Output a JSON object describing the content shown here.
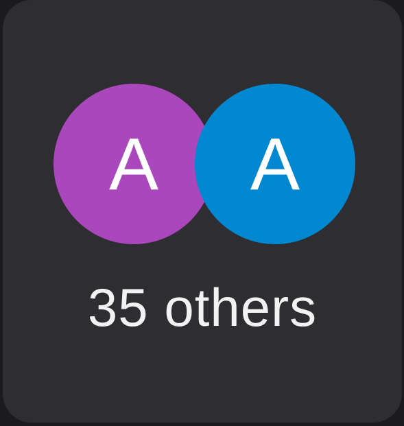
{
  "avatars": [
    {
      "initial": "A",
      "color": "#ab47bc"
    },
    {
      "initial": "A",
      "color": "#0288d1"
    }
  ],
  "caption": "35 others"
}
